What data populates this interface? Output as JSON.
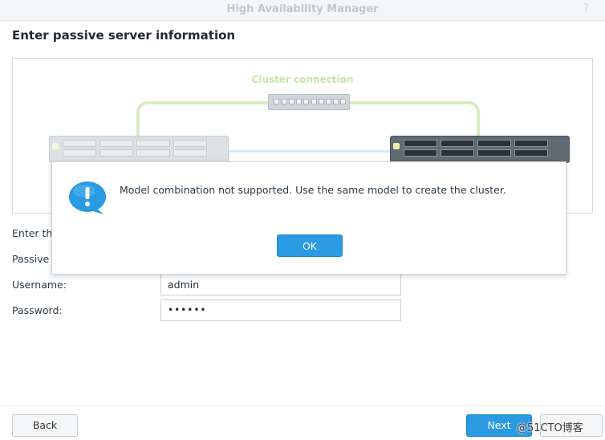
{
  "window": {
    "title": "High Availability Manager",
    "help_glyph": "?"
  },
  "page": {
    "heading": "Enter passive server information"
  },
  "diagram": {
    "cluster_label": "Cluster connection"
  },
  "dialog": {
    "message": "Model combination not supported. Use the same model to create the cluster.",
    "ok_label": "OK",
    "icon": "info-icon",
    "icon_color": "#2a9ae2"
  },
  "form": {
    "intro_label": "Enter th",
    "passive_label": "Passive",
    "username_label": "Username:",
    "username_value": "admin",
    "password_label": "Password:",
    "password_value": "••••••"
  },
  "footer": {
    "back_label": "Back",
    "next_label": "Next",
    "watermark": "@51CTO博客"
  },
  "colors": {
    "accent": "#2a9ae2",
    "cluster_cable": "#d8ecc0",
    "heartbeat_cable": "#d7e9f5"
  }
}
